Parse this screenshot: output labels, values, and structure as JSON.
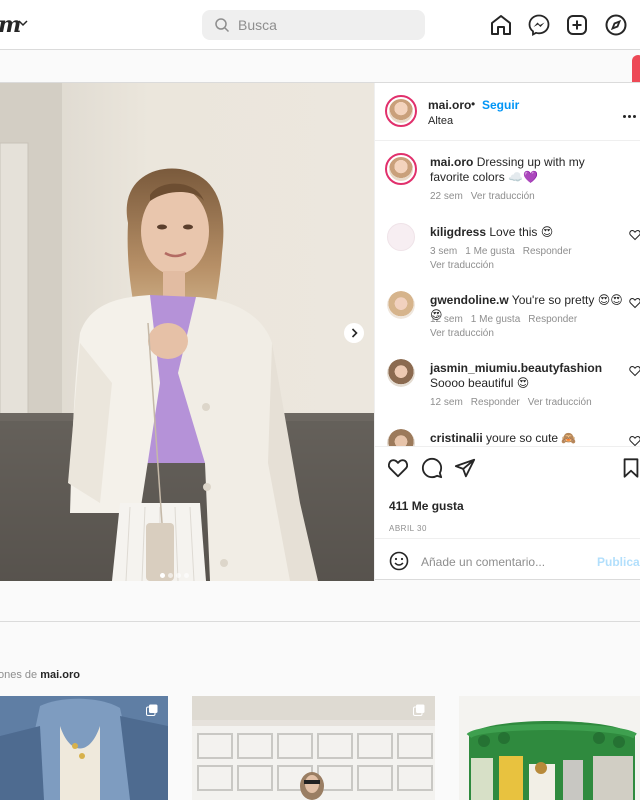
{
  "header": {
    "logo_fragment": "m",
    "search_placeholder": "Busca",
    "icons": [
      "home-icon",
      "messenger-icon",
      "new-post-icon",
      "explore-icon"
    ]
  },
  "post": {
    "username": "mai.oro",
    "dot": "•",
    "follow_label": "Seguir",
    "location": "Altea",
    "caption": {
      "username": "mai.oro",
      "text": "Dressing up with my favorite colors ☁️💜",
      "time": "22 sem",
      "translate": "Ver traducción"
    },
    "comments": [
      {
        "username": "kiligdress",
        "text": "Love this 😍",
        "time": "3 sem",
        "likes": "1 Me gusta",
        "reply": "Responder",
        "translate": "Ver traducción"
      },
      {
        "username": "gwendoline.w",
        "text": "You're so pretty 😍😍😍",
        "time": "12 sem",
        "likes": "1 Me gusta",
        "reply": "Responder",
        "translate": "Ver traducción"
      },
      {
        "username": "jasmin_miumiu.beautyfashion",
        "text": "Soooo beautiful 😍",
        "time": "12 sem",
        "reply": "Responder",
        "translate": "Ver traducción"
      },
      {
        "username": "cristinalii",
        "text": "youre so cute 🙈"
      }
    ],
    "likes": "411 Me gusta",
    "date": "ABRIL 30",
    "add_comment_placeholder": "Añade un comentario...",
    "publish_label": "Publicar",
    "carousel": {
      "count": 4,
      "active": 1
    }
  },
  "more_from": {
    "prefix": "ones de",
    "username": "mai.oro"
  },
  "colors": {
    "link_blue": "#0095f6",
    "publish_disabled": "#b2dffc",
    "story_ring": "#e1306c",
    "blazer_white": "#f4f1ea",
    "lavender_top": "#b592d8"
  }
}
